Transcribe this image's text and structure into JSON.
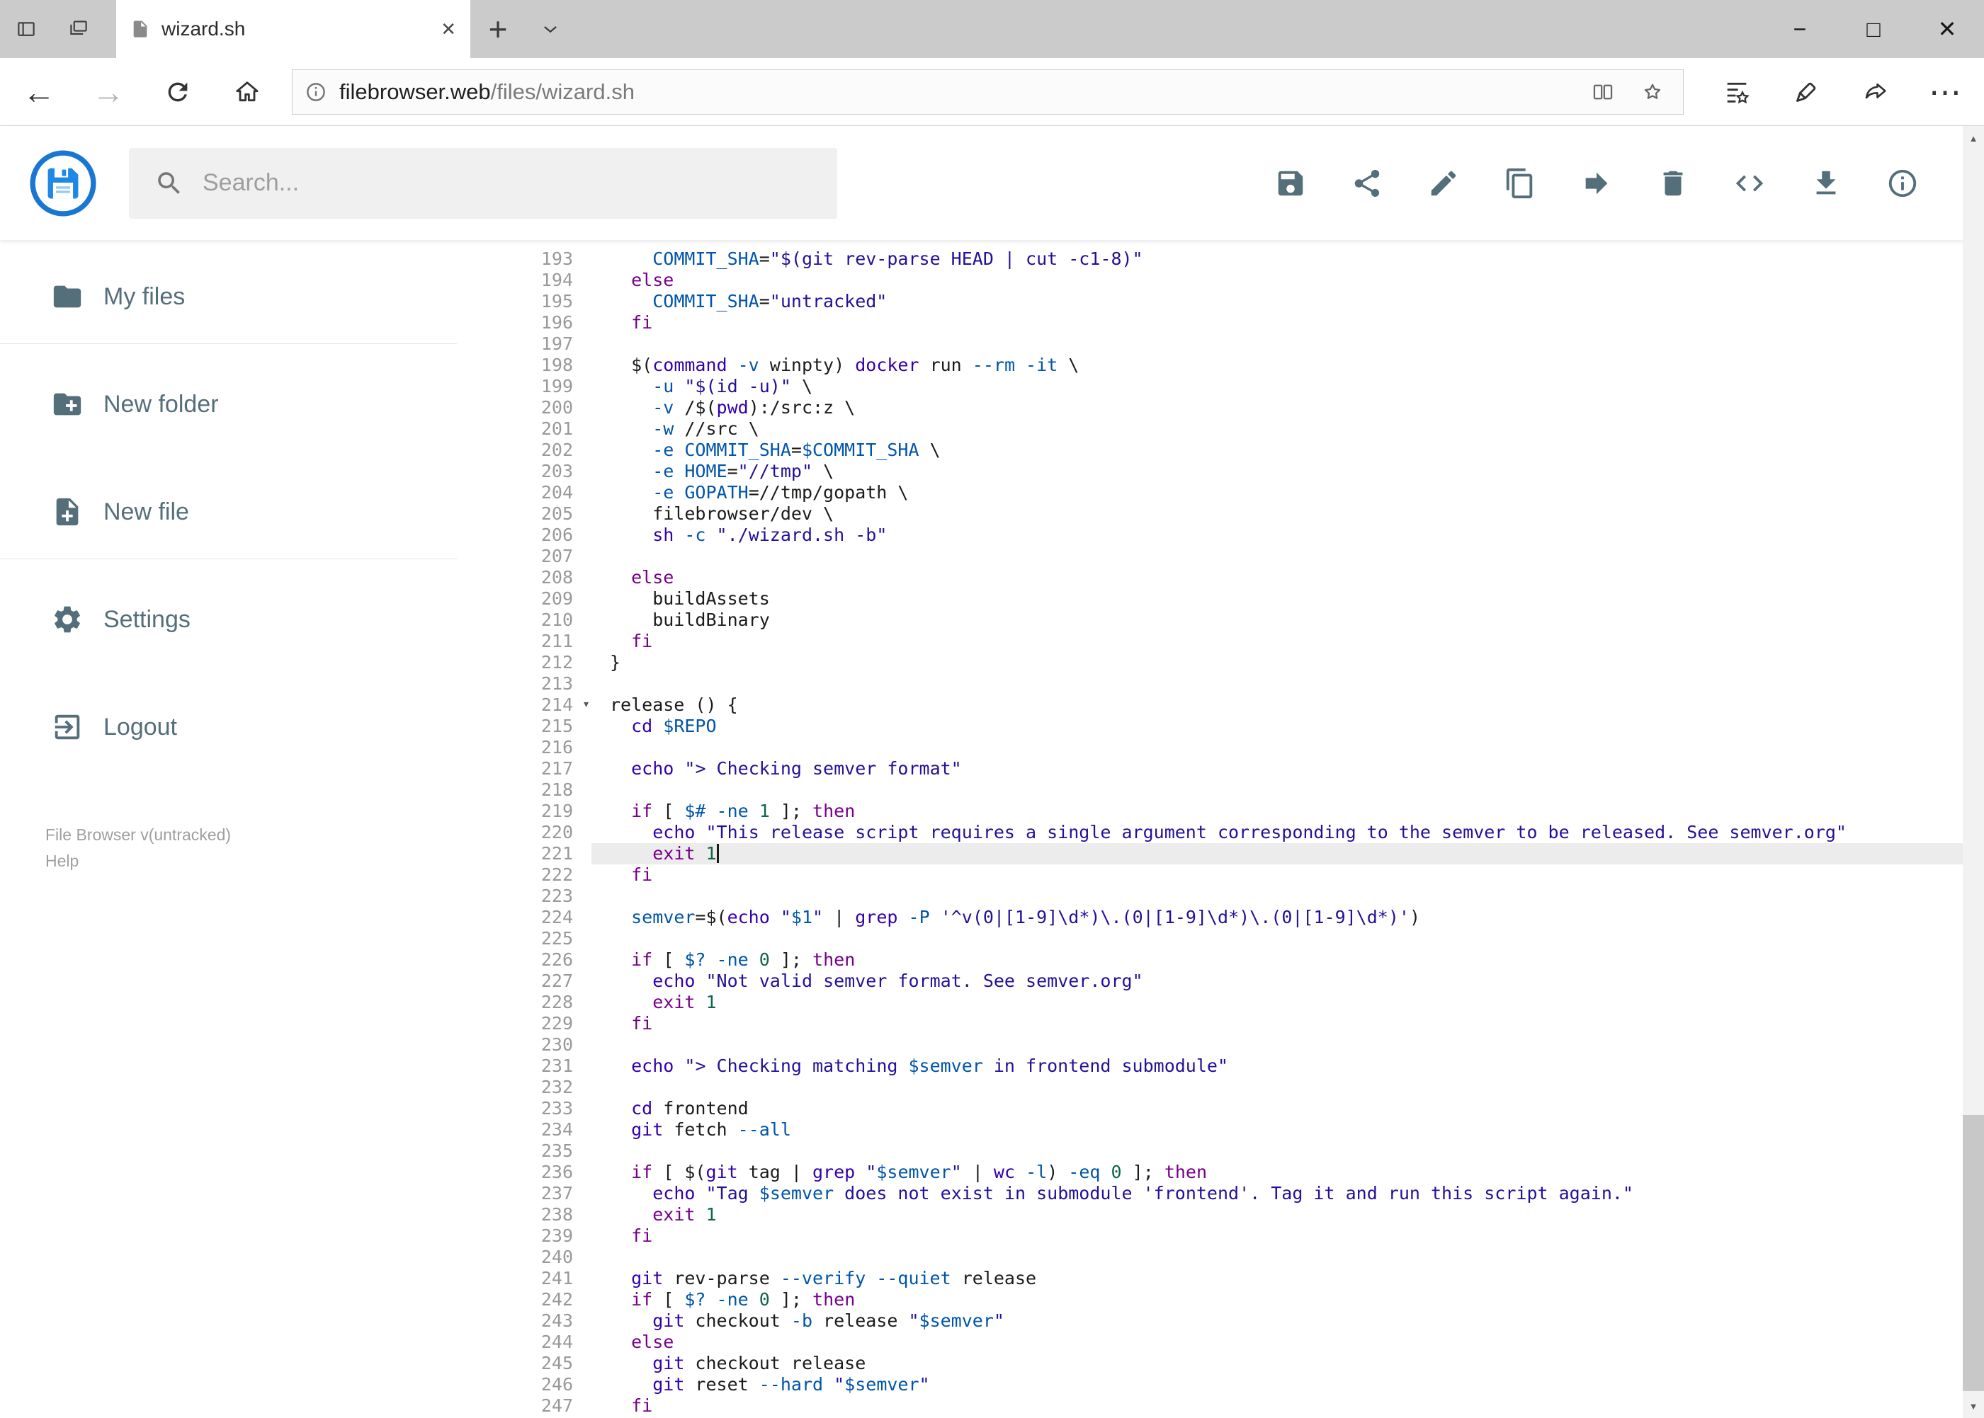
{
  "colors": {
    "accent_blue": "#1e88e5",
    "icon_slate": "#546e7a",
    "tok_keyword": "#770088",
    "tok_builtin": "#3300aa",
    "tok_variable": "#0055aa",
    "tok_flag": "#0055aa",
    "tok_string": "#221199",
    "tok_number": "#116644",
    "active_line_bg": "#ececec"
  },
  "icons": {
    "minimize": "−",
    "maximize": "□",
    "close": "✕",
    "tab_close": "✕",
    "new_tab": "+",
    "back": "←",
    "forward": "→",
    "more": "⋯",
    "fold": "▾",
    "scroll_up": "▲",
    "scroll_down": "▼"
  },
  "browser": {
    "tab_title": "wizard.sh",
    "url": {
      "host": "filebrowser.web",
      "path": "/files/wizard.sh"
    }
  },
  "header": {
    "search_placeholder": "Search...",
    "actions": [
      "save",
      "share",
      "edit",
      "copy",
      "move",
      "delete",
      "code",
      "download",
      "info"
    ]
  },
  "sidebar": {
    "items": [
      {
        "id": "my-files",
        "icon": "folder",
        "label": "My files"
      },
      {
        "divider": true
      },
      {
        "id": "new-folder",
        "icon": "folder-plus",
        "label": "New folder"
      },
      {
        "id": "new-file",
        "icon": "file-plus",
        "label": "New file"
      },
      {
        "divider": true
      },
      {
        "id": "settings",
        "icon": "gear",
        "label": "Settings"
      },
      {
        "id": "logout",
        "icon": "logout",
        "label": "Logout"
      }
    ],
    "footer": {
      "version": "File Browser v(untracked)",
      "help": "Help"
    }
  },
  "editor": {
    "first_line_number": 193,
    "active_line": 221,
    "fold_marker_line": 214,
    "lines": [
      "    COMMIT_SHA=\"$(git rev-parse HEAD | cut -c1-8)\"",
      "  else",
      "    COMMIT_SHA=\"untracked\"",
      "  fi",
      "",
      "  $(command -v winpty) docker run --rm -it \\",
      "    -u \"$(id -u)\" \\",
      "    -v /$(pwd):/src:z \\",
      "    -w //src \\",
      "    -e COMMIT_SHA=$COMMIT_SHA \\",
      "    -e HOME=\"//tmp\" \\",
      "    -e GOPATH=//tmp/gopath \\",
      "    filebrowser/dev \\",
      "    sh -c \"./wizard.sh -b\"",
      "",
      "  else",
      "    buildAssets",
      "    buildBinary",
      "  fi",
      "}",
      "",
      "release () {",
      "  cd $REPO",
      "",
      "  echo \"> Checking semver format\"",
      "",
      "  if [ $# -ne 1 ]; then",
      "    echo \"This release script requires a single argument corresponding to the semver to be released. See semver.org\"",
      "    exit 1",
      "  fi",
      "",
      "  semver=$(echo \"$1\" | grep -P '^v(0|[1-9]\\d*)\\.(0|[1-9]\\d*)\\.(0|[1-9]\\d*)')",
      "",
      "  if [ $? -ne 0 ]; then",
      "    echo \"Not valid semver format. See semver.org\"",
      "    exit 1",
      "  fi",
      "",
      "  echo \"> Checking matching $semver in frontend submodule\"",
      "",
      "  cd frontend",
      "  git fetch --all",
      "",
      "  if [ $(git tag | grep \"$semver\" | wc -l) -eq 0 ]; then",
      "    echo \"Tag $semver does not exist in submodule 'frontend'. Tag it and run this script again.\"",
      "    exit 1",
      "  fi",
      "",
      "  git rev-parse --verify --quiet release",
      "  if [ $? -ne 0 ]; then",
      "    git checkout -b release \"$semver\"",
      "  else",
      "    git checkout release",
      "    git reset --hard \"$semver\"",
      "  fi"
    ]
  }
}
